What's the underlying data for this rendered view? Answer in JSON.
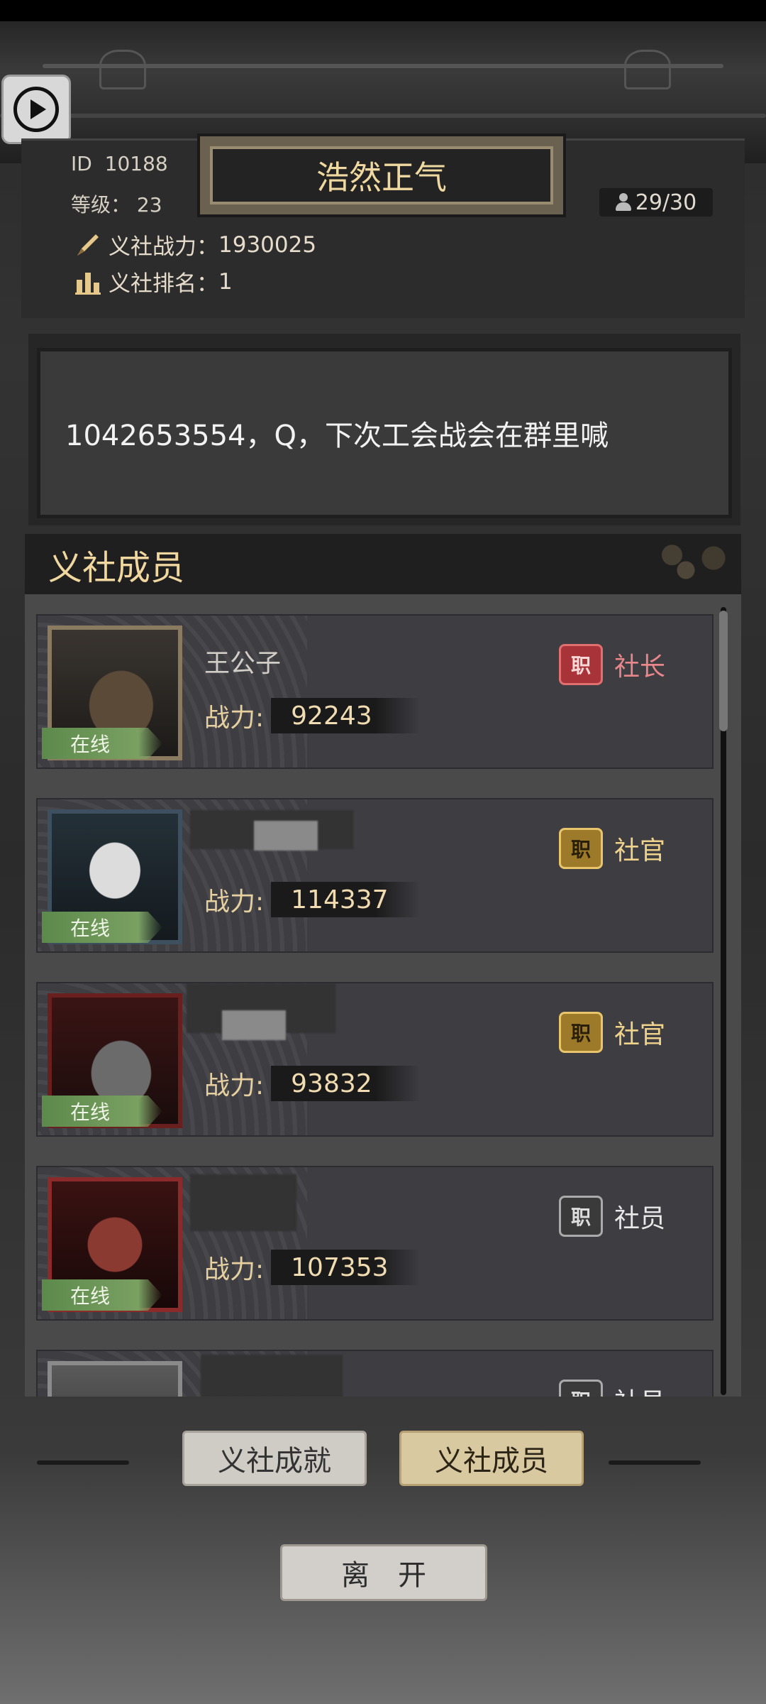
{
  "guild": {
    "id_label": "ID",
    "id_value": "10188",
    "level_label": "等级：",
    "level_value": "23",
    "name": "浩然正气",
    "member_count": "29/30",
    "power_label": "义社战力：",
    "power_value": "1930025",
    "rank_label": "义社排名：",
    "rank_value": "1",
    "notice": "1042653554，Q，下次工会战会在群里喊"
  },
  "section": {
    "title": "义社成员"
  },
  "members": [
    {
      "name": "王公子",
      "online": "在线",
      "power_label": "战力:",
      "power": "92243",
      "role_badge": "职",
      "role": "社长"
    },
    {
      "name": "",
      "online": "在线",
      "power_label": "战力:",
      "power": "114337",
      "role_badge": "职",
      "role": "社官"
    },
    {
      "name": "",
      "online": "在线",
      "power_label": "战力:",
      "power": "93832",
      "role_badge": "职",
      "role": "社官"
    },
    {
      "name": "",
      "online": "在线",
      "power_label": "战力:",
      "power": "107353",
      "role_badge": "职",
      "role": "社员"
    },
    {
      "name": "",
      "online": "",
      "power_label": "",
      "power": "",
      "role_badge": "职",
      "role": "社员"
    }
  ],
  "tabs": [
    {
      "label": "义社成就"
    },
    {
      "label": "义社成员"
    }
  ],
  "leave_button": "离开",
  "colors": {
    "gold_text": "#f0d9a0",
    "leader_red": "#e8868a",
    "officer_gold": "#f0d38a",
    "online_green": "#7aa062"
  },
  "icons": [
    "play-icon",
    "user-icon",
    "brush-icon",
    "bar-chart-icon"
  ]
}
